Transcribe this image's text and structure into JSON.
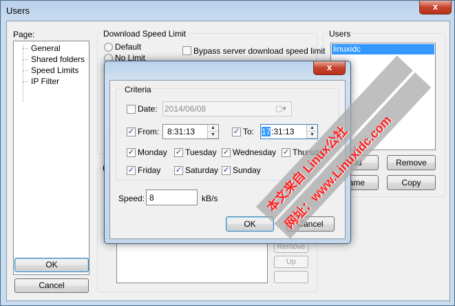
{
  "outer": {
    "title": "Users",
    "close_glyph": "x",
    "page_label": "Page:",
    "pages": [
      "General",
      "Shared folders",
      "Speed Limits",
      "IP Filter"
    ],
    "speed_group_label": "Download Speed Limit",
    "radios": [
      "Default",
      "No Limit"
    ],
    "bypass_label": "Bypass server download speed limit",
    "users_label": "Users",
    "users": [
      "linuxidc"
    ],
    "add_label": "Add",
    "remove_label": "Remove",
    "rename_label": "name",
    "copy_label": "Copy",
    "ok_label": "OK",
    "cancel_label": "Cancel",
    "partial_u": "U",
    "remove_small": "Remove",
    "up_small": "Up"
  },
  "dialog": {
    "close_glyph": "x",
    "criteria_label": "Criteria",
    "date": {
      "label": "Date:",
      "checked": false,
      "value": "2014/06/08"
    },
    "from": {
      "label": "From:",
      "checked": true,
      "value": "8:31:13"
    },
    "to": {
      "label": "To:",
      "checked": true,
      "value_selected": "17",
      "value_rest": ":31:13"
    },
    "days": [
      {
        "label": "Monday",
        "checked": true
      },
      {
        "label": "Tuesday",
        "checked": true
      },
      {
        "label": "Wednesday",
        "checked": true
      },
      {
        "label": "Thursday",
        "checked": true
      },
      {
        "label": "Friday",
        "checked": true
      },
      {
        "label": "Saturday",
        "checked": true
      },
      {
        "label": "Sunday",
        "checked": true
      }
    ],
    "speed_label": "Speed:",
    "speed_value": "8",
    "speed_unit": "kB/s",
    "ok_label": "OK",
    "cancel_label": "Cancel"
  },
  "watermark": {
    "line1": "本文来自 Linux公社",
    "line2": "网址：www.Linuxidc.com"
  },
  "colors": {
    "titlebar": "#b9d1ea",
    "selection": "#3399ff",
    "close": "#c7432d"
  }
}
